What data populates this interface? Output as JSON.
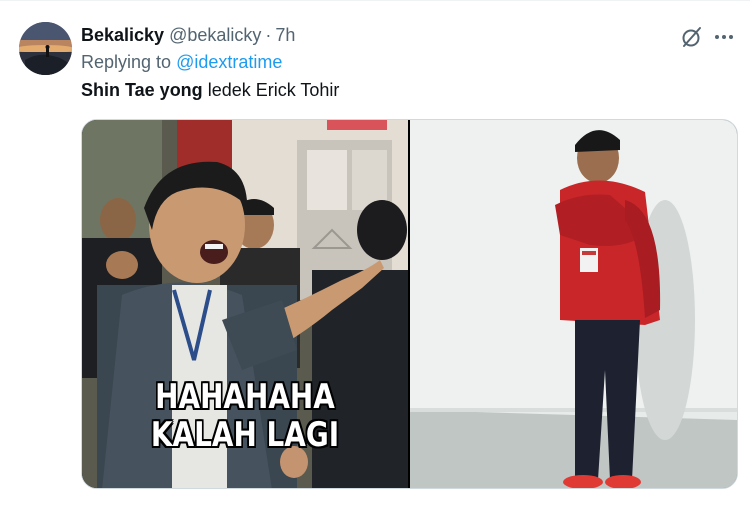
{
  "tweet": {
    "display_name": "Bekalicky",
    "handle": "@bekalicky",
    "separator": "·",
    "time": "7h",
    "replying_prefix": "Replying to ",
    "replying_to": "@idextratime",
    "text_bold": "Shin Tae yong",
    "text_rest": " ledek Erick Tohir"
  },
  "media": {
    "left_caption_line1": "HAHAHAHA",
    "left_caption_line2": "KALAH LAGI"
  },
  "icons": {
    "grok": "grok-icon",
    "more": "more-options-icon"
  },
  "colors": {
    "link": "#1d9bf0",
    "secondary_text": "#536471",
    "primary_text": "#0f1419"
  }
}
